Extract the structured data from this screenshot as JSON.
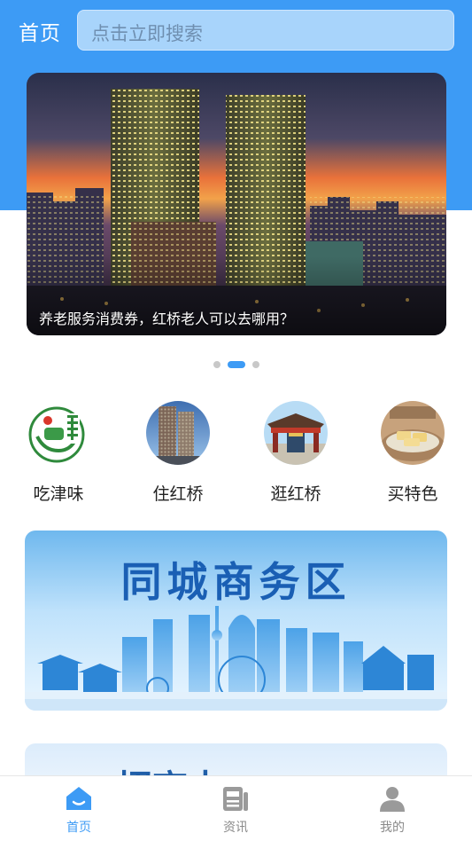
{
  "header": {
    "title": "首页",
    "search_placeholder": "点击立即搜索"
  },
  "hero": {
    "caption": "养老服务消费券，红桥老人可以去哪用？",
    "dots_total": 3,
    "dots_active_index": 1
  },
  "categories": [
    {
      "label": "吃津味",
      "icon": "restaurant-logo-icon"
    },
    {
      "label": "住红桥",
      "icon": "hotel-building-icon"
    },
    {
      "label": "逛红桥",
      "icon": "landmark-gate-icon"
    },
    {
      "label": "买特色",
      "icon": "local-snack-icon"
    }
  ],
  "banners": {
    "business_title": "同城商务区",
    "next_partial_title": "招商中"
  },
  "tabbar": {
    "items": [
      {
        "label": "首页",
        "icon": "home-icon",
        "active": true
      },
      {
        "label": "资讯",
        "icon": "news-icon",
        "active": false
      },
      {
        "label": "我的",
        "icon": "profile-icon",
        "active": false
      }
    ]
  },
  "colors": {
    "accent": "#3d9bf5",
    "tab_inactive": "#8a8a8a",
    "banner_title": "#1a5fb4"
  }
}
